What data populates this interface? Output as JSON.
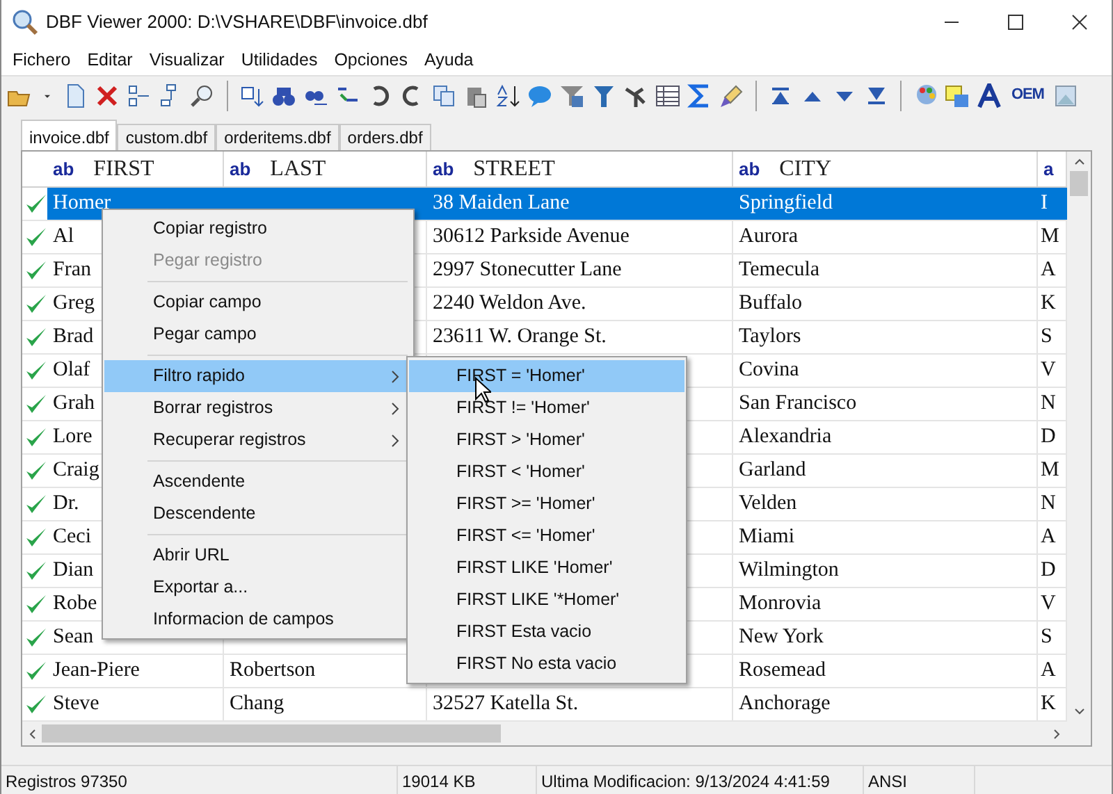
{
  "window": {
    "title": "DBF Viewer 2000: D:\\VSHARE\\DBF\\invoice.dbf"
  },
  "menu_bar": [
    "Fichero",
    "Editar",
    "Visualizar",
    "Utilidades",
    "Opciones",
    "Ayuda"
  ],
  "toolbar": {
    "oem_label": "OEM"
  },
  "tabs": [
    {
      "label": "invoice.dbf",
      "selected": true
    },
    {
      "label": "custom.dbf",
      "selected": false
    },
    {
      "label": "orderitems.dbf",
      "selected": false
    },
    {
      "label": "orders.dbf",
      "selected": false
    }
  ],
  "table": {
    "columns": [
      {
        "type_label": "ab",
        "name": "FIRST"
      },
      {
        "type_label": "ab",
        "name": "LAST"
      },
      {
        "type_label": "ab",
        "name": "STREET"
      },
      {
        "type_label": "ab",
        "name": "CITY"
      },
      {
        "type_label": "a"
      }
    ],
    "rows": [
      {
        "selected": true,
        "cells": [
          "Homer",
          "",
          "38 Maiden Lane",
          "Springfield",
          "I"
        ]
      },
      {
        "selected": false,
        "cells": [
          "Al",
          "",
          "30612 Parkside Avenue",
          "Aurora",
          "M"
        ]
      },
      {
        "selected": false,
        "cells": [
          "Fran",
          "",
          "2997 Stonecutter Lane",
          "Temecula",
          "A"
        ]
      },
      {
        "selected": false,
        "cells": [
          "Greg",
          "",
          "2240 Weldon Ave.",
          "Buffalo",
          "K"
        ]
      },
      {
        "selected": false,
        "cells": [
          "Brad",
          "",
          "23611 W. Orange St.",
          "Taylors",
          "S"
        ]
      },
      {
        "selected": false,
        "cells": [
          "Olaf",
          "",
          "",
          "Covina",
          "V"
        ]
      },
      {
        "selected": false,
        "cells": [
          "Grah",
          "",
          "",
          "San Francisco",
          "N"
        ]
      },
      {
        "selected": false,
        "cells": [
          "Lore",
          "",
          "",
          "Alexandria",
          "D"
        ]
      },
      {
        "selected": false,
        "cells": [
          "Craig",
          "",
          "",
          "Garland",
          "M"
        ]
      },
      {
        "selected": false,
        "cells": [
          "Dr.",
          "",
          "",
          "Velden",
          "N"
        ]
      },
      {
        "selected": false,
        "cells": [
          "Ceci",
          "",
          "",
          "Miami",
          "A"
        ]
      },
      {
        "selected": false,
        "cells": [
          "Dian",
          "",
          "",
          "Wilmington",
          "D"
        ]
      },
      {
        "selected": false,
        "cells": [
          "Robe",
          "",
          "",
          "Monrovia",
          "V"
        ]
      },
      {
        "selected": false,
        "cells": [
          "Sean",
          "",
          "",
          "New York",
          "S"
        ]
      },
      {
        "selected": false,
        "cells": [
          "Jean-Piere",
          "Robertson",
          "",
          "Rosemead",
          "A"
        ]
      },
      {
        "selected": false,
        "cells": [
          "Steve",
          "Chang",
          "32527 Katella St.",
          "Anchorage",
          "K"
        ]
      }
    ]
  },
  "context_menu": [
    {
      "kind": "item",
      "label": "Copiar registro",
      "disabled": false,
      "selected": false,
      "submenu": false
    },
    {
      "kind": "item",
      "label": "Pegar registro",
      "disabled": true,
      "selected": false,
      "submenu": false
    },
    {
      "kind": "separator"
    },
    {
      "kind": "item",
      "label": "Copiar campo",
      "disabled": false,
      "selected": false,
      "submenu": false
    },
    {
      "kind": "item",
      "label": "Pegar campo",
      "disabled": false,
      "selected": false,
      "submenu": false
    },
    {
      "kind": "separator"
    },
    {
      "kind": "item",
      "label": "Filtro rapido",
      "disabled": false,
      "selected": true,
      "submenu": true
    },
    {
      "kind": "item",
      "label": "Borrar registros",
      "disabled": false,
      "selected": false,
      "submenu": true
    },
    {
      "kind": "item",
      "label": "Recuperar registros",
      "disabled": false,
      "selected": false,
      "submenu": true
    },
    {
      "kind": "separator"
    },
    {
      "kind": "item",
      "label": "Ascendente",
      "disabled": false,
      "selected": false,
      "submenu": false
    },
    {
      "kind": "item",
      "label": "Descendente",
      "disabled": false,
      "selected": false,
      "submenu": false
    },
    {
      "kind": "separator"
    },
    {
      "kind": "item",
      "label": "Abrir URL",
      "disabled": false,
      "selected": false,
      "submenu": false
    },
    {
      "kind": "item",
      "label": "Exportar a...",
      "disabled": false,
      "selected": false,
      "submenu": false
    },
    {
      "kind": "item",
      "label": "Informacion de campos",
      "disabled": false,
      "selected": false,
      "submenu": false
    }
  ],
  "submenu": [
    {
      "label": "FIRST = 'Homer'",
      "selected": true
    },
    {
      "label": "FIRST != 'Homer'",
      "selected": false
    },
    {
      "label": "FIRST > 'Homer'",
      "selected": false
    },
    {
      "label": "FIRST < 'Homer'",
      "selected": false
    },
    {
      "label": "FIRST >= 'Homer'",
      "selected": false
    },
    {
      "label": "FIRST <= 'Homer'",
      "selected": false
    },
    {
      "label": "FIRST LIKE 'Homer'",
      "selected": false
    },
    {
      "label": "FIRST LIKE '*Homer'",
      "selected": false
    },
    {
      "label": "FIRST Esta vacio",
      "selected": false
    },
    {
      "label": "FIRST No esta vacio",
      "selected": false
    }
  ],
  "status_bar": [
    "Registros 97350",
    "19014 KB",
    "Ultima Modificacion: 9/13/2024 4:41:59",
    "ANSI"
  ]
}
